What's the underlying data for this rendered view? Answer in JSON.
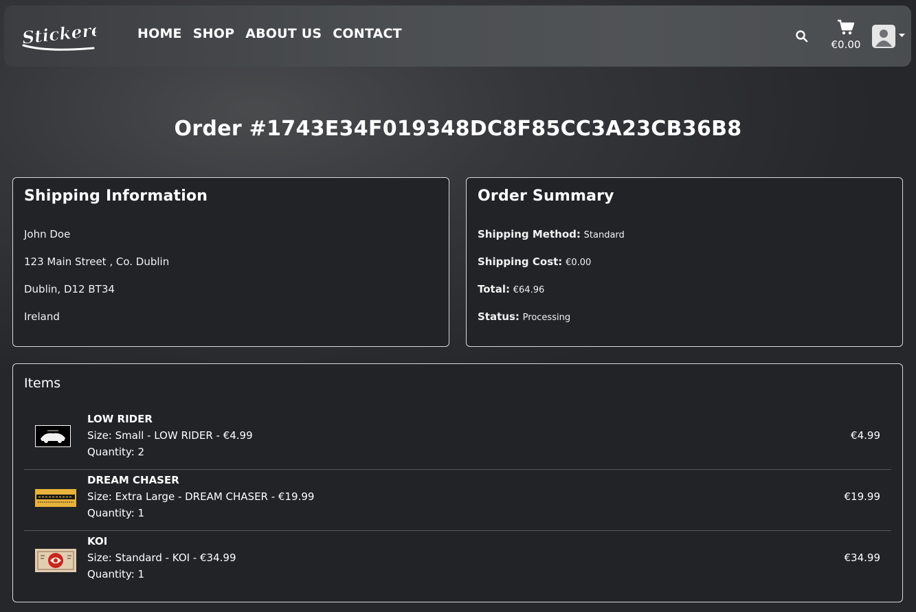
{
  "brand": {
    "logo_text": "Stickered"
  },
  "nav": {
    "links": [
      "HOME",
      "SHOP",
      "ABOUT US",
      "CONTACT"
    ],
    "cart_total": "€0.00"
  },
  "page": {
    "title": "Order #1743E34F019348DC8F85CC3A23CB36B8"
  },
  "shipping": {
    "heading": "Shipping Information",
    "name": "John Doe",
    "address_line": "123 Main Street , Co. Dublin",
    "city_line": "Dublin, D12 BT34",
    "country": "Ireland"
  },
  "summary": {
    "heading": "Order Summary",
    "method_label": "Shipping Method:",
    "method_value": "Standard",
    "cost_label": "Shipping Cost:",
    "cost_value": "€0.00",
    "total_label": "Total:",
    "total_value": "€64.96",
    "status_label": "Status:",
    "status_value": "Processing"
  },
  "items": {
    "heading": "Items",
    "list": [
      {
        "name": "LOW RIDER",
        "desc": "Size: Small - LOW RIDER - €4.99",
        "qty": "Quantity: 2",
        "price": "€4.99"
      },
      {
        "name": "DREAM CHASER",
        "desc": "Size: Extra Large - DREAM CHASER - €19.99",
        "qty": "Quantity: 1",
        "price": "€19.99"
      },
      {
        "name": "KOI",
        "desc": "Size: Standard - KOI - €34.99",
        "qty": "Quantity: 1",
        "price": "€34.99"
      }
    ]
  },
  "colors": {
    "card_bg": "#212327",
    "card_border": "#d9dadc",
    "navbar": "#4c4f52",
    "dream_chaser_sticker": "#e8b33a",
    "koi_red": "#c8251f"
  }
}
